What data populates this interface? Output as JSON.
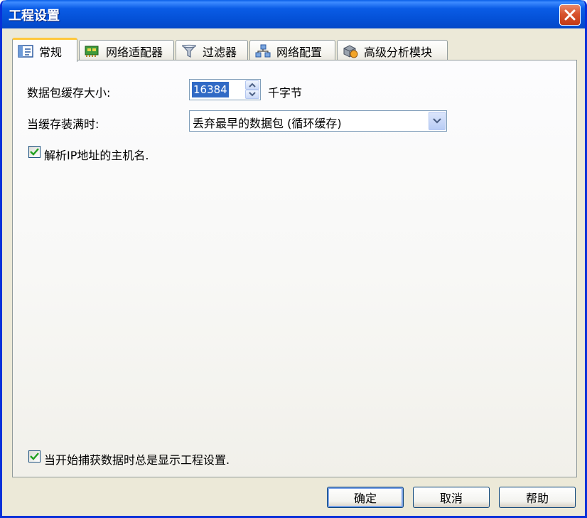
{
  "window": {
    "title": "工程设置"
  },
  "tabs": [
    {
      "label": "常规",
      "icon": "general-icon",
      "active": true
    },
    {
      "label": "网络适配器",
      "icon": "adapter-icon",
      "active": false
    },
    {
      "label": "过滤器",
      "icon": "filter-icon",
      "active": false
    },
    {
      "label": "网络配置",
      "icon": "network-icon",
      "active": false
    },
    {
      "label": "高级分析模块",
      "icon": "analysis-module-icon",
      "active": false
    }
  ],
  "general": {
    "buffer_size_label": "数据包缓存大小:",
    "buffer_size_value": "16384",
    "buffer_size_unit": "千字节",
    "when_full_label": "当缓存装满时:",
    "when_full_value": "丢弃最早的数据包 (循环缓存)",
    "resolve_ip_label": "解析IP地址的主机名.",
    "resolve_ip_checked": true,
    "show_on_start_label": "当开始捕获数据时总是显示工程设置.",
    "show_on_start_checked": true
  },
  "buttons": {
    "ok": "确定",
    "cancel": "取消",
    "help": "帮助"
  },
  "colors": {
    "titlebar": "#0450D6",
    "selection": "#316AC5",
    "active_tab_accent": "#FFC83C",
    "check_mark": "#21A121"
  }
}
